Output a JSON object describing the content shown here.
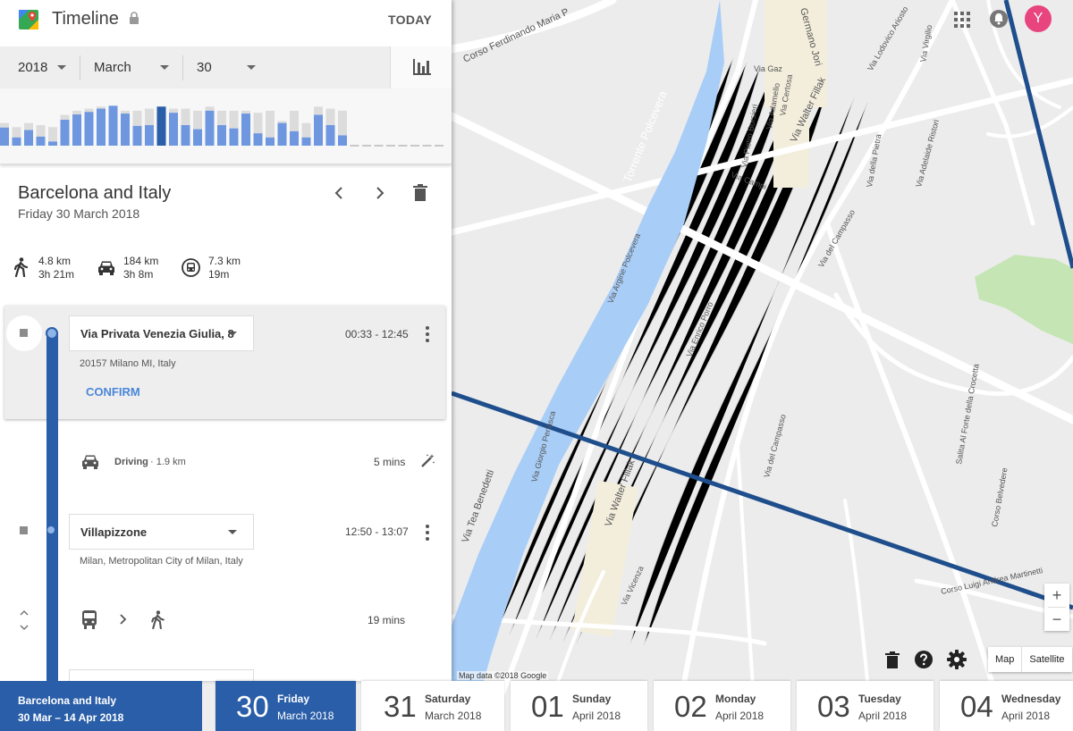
{
  "header": {
    "title": "Timeline",
    "today_label": "TODAY"
  },
  "date_selector": {
    "year": "2018",
    "month": "March",
    "day": "30"
  },
  "day": {
    "title": "Barcelona and Italy",
    "subtitle": "Friday 30 March 2018"
  },
  "stats": [
    {
      "icon": "walking-icon",
      "distance": "4.8 km",
      "duration": "3h 21m"
    },
    {
      "icon": "car-icon",
      "distance": "184 km",
      "duration": "3h 8m"
    },
    {
      "icon": "train-icon",
      "distance": "7.3 km",
      "duration": "19m"
    }
  ],
  "timeline": {
    "stop1": {
      "name": "Via Privata Venezia Giulia, 8",
      "time": "00:33 - 12:45",
      "address": "20157 Milano MI, Italy",
      "confirm_label": "CONFIRM"
    },
    "move1": {
      "mode": "Driving",
      "distance": "· 1.9 km",
      "duration": "5 mins"
    },
    "stop2": {
      "name": "Villapizzone",
      "time": "12:50 - 13:07",
      "address": "Milan, Metropolitan City of Milan, Italy"
    },
    "move2": {
      "duration": "19 mins"
    }
  },
  "histogram": {
    "bars": [
      0.44,
      0.2,
      0.38,
      0.22,
      0.1,
      0.63,
      0.76,
      0.82,
      0.9,
      0.97,
      0.78,
      0.48,
      0.5,
      0.95,
      0.8,
      0.5,
      0.4,
      0.85,
      0.5,
      0.42,
      0.78,
      0.3,
      0.2,
      0.55,
      0.35,
      0.2,
      0.75,
      0.5,
      0.25,
      0,
      0,
      0,
      0,
      0,
      0,
      0,
      0
    ],
    "ghost": [
      0.55,
      0.45,
      0.55,
      0.5,
      0.45,
      0.75,
      0.85,
      0.9,
      0.95,
      0.97,
      0.85,
      0.85,
      0.9,
      0.95,
      0.9,
      0.9,
      0.85,
      0.95,
      0.85,
      0.85,
      0.85,
      0.8,
      0.85,
      0.6,
      0.85,
      0.55,
      0.95,
      0.9,
      0.85,
      0.1,
      0.1,
      0.1,
      0.1,
      0.1,
      0.1,
      0.1,
      0.1
    ],
    "selected_index": 13,
    "colors": {
      "bar": "#6e97e0",
      "selected": "#2a5ea8",
      "ghost": "#dcdcdc"
    }
  },
  "bottom_bar": {
    "range": {
      "title": "Barcelona and Italy",
      "dates": "30 Mar – 14 Apr 2018"
    },
    "days": [
      {
        "num": "30",
        "name": "Friday",
        "month": "March 2018",
        "selected": true
      },
      {
        "num": "31",
        "name": "Saturday",
        "month": "March 2018"
      },
      {
        "num": "01",
        "name": "Sunday",
        "month": "April 2018"
      },
      {
        "num": "02",
        "name": "Monday",
        "month": "April 2018"
      },
      {
        "num": "03",
        "name": "Tuesday",
        "month": "April 2018"
      },
      {
        "num": "04",
        "name": "Wednesday",
        "month": "April 2018"
      }
    ]
  },
  "map": {
    "attribution": "Map data ©2018 Google",
    "map_label": "Map",
    "satellite_label": "Satellite",
    "zoom_in": "+",
    "zoom_out": "−",
    "street_labels": [
      {
        "text": "Torrente Polcevera"
      },
      {
        "text": "Corso Ferdinando Maria P"
      },
      {
        "text": "Germano Jori"
      },
      {
        "text": "Via Walter Fillak"
      },
      {
        "text": "Via Campi"
      },
      {
        "text": "Via Argine Polcevera"
      },
      {
        "text": "Via Enrico Porro"
      },
      {
        "text": "Via del Campasso"
      },
      {
        "text": "Salita Al Forte della Crocetta"
      },
      {
        "text": "Corso Belvedere"
      },
      {
        "text": "Via Tea Benedetti"
      },
      {
        "text": "Via Walter Fillak"
      },
      {
        "text": "Via Vicenza"
      },
      {
        "text": "Corso Luigi Andrea Martinetti"
      },
      {
        "text": "Via Gaz"
      },
      {
        "text": "Via Adamello"
      },
      {
        "text": "Via Certosa"
      },
      {
        "text": "Via Pietro Borsieri"
      },
      {
        "text": "Via Lodovico Ariosto"
      },
      {
        "text": "Via Virgilio"
      },
      {
        "text": "Via della Pietra"
      },
      {
        "text": "Via Adelaide Ristori"
      },
      {
        "text": "Via Giorgio Perlasca"
      },
      {
        "text": "Via del Campasso"
      }
    ],
    "colors": {
      "route": "#1f4e8c",
      "river": "#a8cdf7",
      "park": "#c5e6b4"
    }
  },
  "user": {
    "avatar_letter": "Y"
  }
}
